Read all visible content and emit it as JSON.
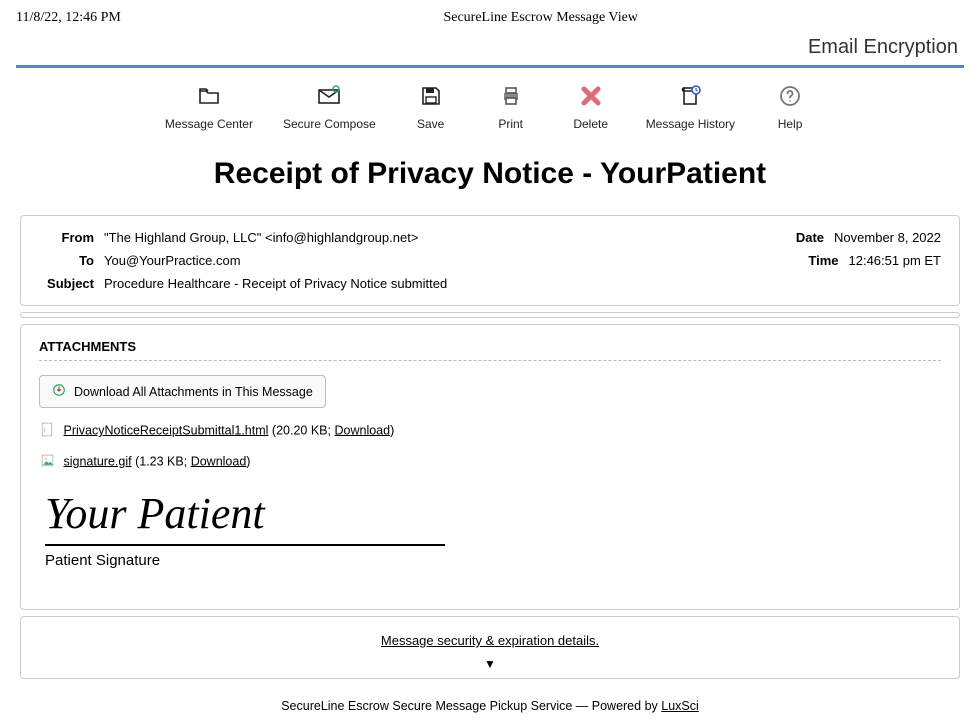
{
  "meta": {
    "timestamp": "11/8/22, 12:46 PM",
    "window_title": "SecureLine Escrow Message View",
    "brand": "Email Encryption"
  },
  "toolbar": {
    "message_center": "Message Center",
    "secure_compose": "Secure Compose",
    "save": "Save",
    "print": "Print",
    "delete": "Delete",
    "message_history": "Message History",
    "help": "Help"
  },
  "title": "Receipt of Privacy Notice - YourPatient",
  "headers": {
    "from_label": "From",
    "from_value": "\"The Highland Group, LLC\" <info@highlandgroup.net>",
    "to_label": "To",
    "to_value": "You@YourPractice.com",
    "subject_label": "Subject",
    "subject_value": "Procedure Healthcare - Receipt of Privacy Notice submitted",
    "date_label": "Date",
    "date_value": "November 8, 2022",
    "time_label": "Time",
    "time_value": "12:46:51 pm ET"
  },
  "attachments": {
    "section_title": "ATTACHMENTS",
    "download_all": "Download All Attachments in This Message",
    "items": [
      {
        "name": "PrivacyNoticeReceiptSubmittal1.html",
        "size": "20.20 KB",
        "download_label": "Download"
      },
      {
        "name": "signature.gif",
        "size": "1.23 KB",
        "download_label": "Download"
      }
    ]
  },
  "signature": {
    "script_text": "Your Patient",
    "caption": "Patient Signature"
  },
  "security": {
    "link": "Message security & expiration details."
  },
  "footer": {
    "prefix": "SecureLine Escrow Secure Message Pickup Service — Powered by ",
    "powered_by": "LuxSci"
  }
}
